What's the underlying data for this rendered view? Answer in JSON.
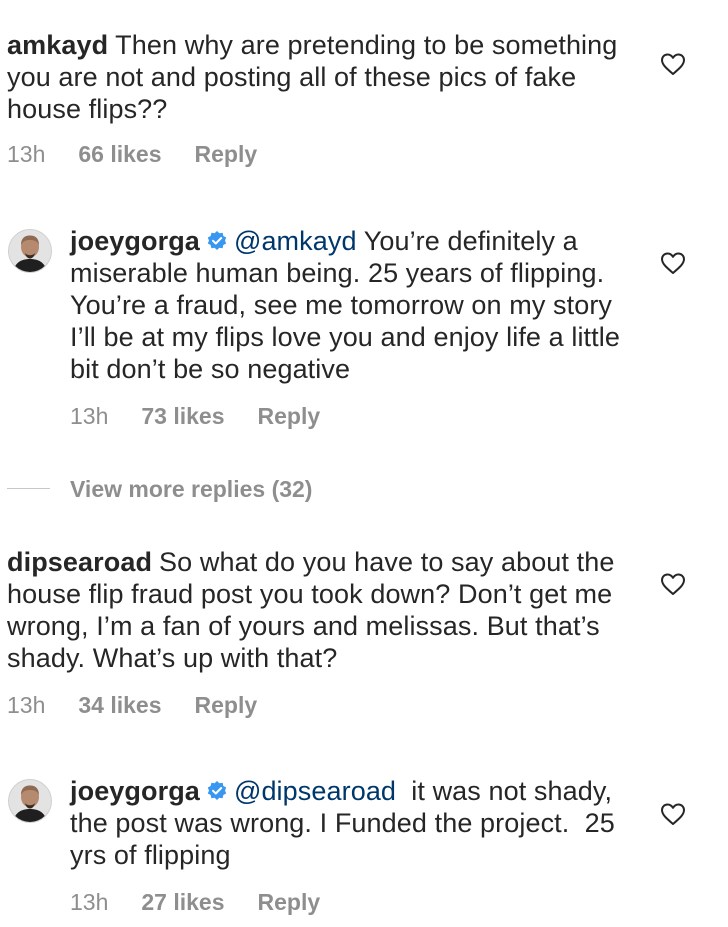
{
  "comments": [
    {
      "username": "amkayd",
      "mention": "",
      "text": "Then why are pretending to be something you are not and posting all of these pics of fake house flips??",
      "time": "13h",
      "likes": "66 likes",
      "reply_label": "Reply"
    },
    {
      "username": "joeygorga",
      "mention": "@amkayd",
      "text": " You’re definitely a miserable human being. 25 years of flipping. You’re a fraud, see me tomorrow on my story I’ll be at my flips love you and enjoy life a little bit don’t be so negative",
      "time": "13h",
      "likes": "73 likes",
      "reply_label": "Reply"
    },
    {
      "username": "dipsearoad",
      "mention": "",
      "text": "So what do you have to say about the house flip fraud post you took down? Don’t get me wrong, I’m a fan of yours and melissas. But that’s shady. What’s up with that?",
      "time": "13h",
      "likes": "34 likes",
      "reply_label": "Reply"
    },
    {
      "username": "joeygorga",
      "mention": "@dipsearoad",
      "text": "  it was not shady, the post was wrong. I Funded the project.  25 yrs of flipping",
      "time": "13h",
      "likes": "27 likes",
      "reply_label": "Reply"
    }
  ],
  "view_more": "View more replies (32)",
  "icons": {
    "like": "heart-outline-icon",
    "verified": "verified-badge-icon"
  },
  "colors": {
    "verified": "#3897f0",
    "muted": "#8e8e8e",
    "mention": "#00376b"
  }
}
